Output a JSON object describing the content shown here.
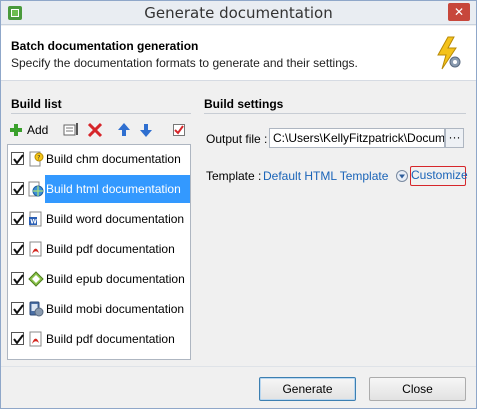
{
  "window": {
    "title": "Generate documentation",
    "close_glyph": "✕"
  },
  "header": {
    "title": "Batch documentation generation",
    "subtitle": "Specify the documentation formats to generate and their settings."
  },
  "build_list": {
    "label": "Build list",
    "toolbar": {
      "add_label": "Add"
    },
    "items": [
      {
        "label": "Build chm documentation",
        "checked": true,
        "icon": "chm-help-icon",
        "selected": false
      },
      {
        "label": "Build html documentation",
        "checked": true,
        "icon": "html-globe-icon",
        "selected": true
      },
      {
        "label": "Build word documentation",
        "checked": true,
        "icon": "word-document-icon",
        "selected": false
      },
      {
        "label": "Build pdf documentation",
        "checked": true,
        "icon": "pdf-document-icon",
        "selected": false
      },
      {
        "label": "Build epub documentation",
        "checked": true,
        "icon": "epub-icon",
        "selected": false
      },
      {
        "label": "Build mobi documentation",
        "checked": true,
        "icon": "mobi-icon",
        "selected": false
      },
      {
        "label": "Build pdf documentation",
        "checked": true,
        "icon": "pdf-document-icon",
        "selected": false
      }
    ]
  },
  "build_settings": {
    "label": "Build settings",
    "output_file_label": "Output file :",
    "output_file_value": "C:\\Users\\KellyFitzpatrick\\Documents",
    "browse_label": "···",
    "template_label": "Template :",
    "template_value": "Default HTML Template",
    "customize_label": "Customize"
  },
  "footer": {
    "generate_label": "Generate",
    "close_label": "Close"
  },
  "colors": {
    "selection": "#3399ff",
    "link": "#1a64b8",
    "highlight_border": "#d6262a"
  }
}
